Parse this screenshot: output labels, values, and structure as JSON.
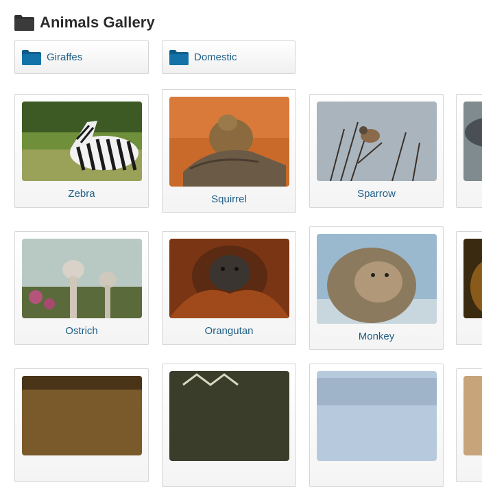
{
  "header": {
    "title": "Animals Gallery",
    "icon": "folder-icon"
  },
  "folders": [
    {
      "label": "Giraffes",
      "icon": "folder-icon"
    },
    {
      "label": "Domestic",
      "icon": "folder-icon"
    }
  ],
  "gallery": {
    "items": [
      {
        "label": "Zebra"
      },
      {
        "label": "Squirrel"
      },
      {
        "label": "Sparrow"
      },
      {
        "label": "Ostrich"
      },
      {
        "label": "Orangutan"
      },
      {
        "label": "Monkey"
      }
    ]
  },
  "colors": {
    "link": "#1f5f86",
    "folder_icon": "#0f6a9e",
    "title": "#2b2b2b",
    "card_border": "#d6d6d6"
  }
}
